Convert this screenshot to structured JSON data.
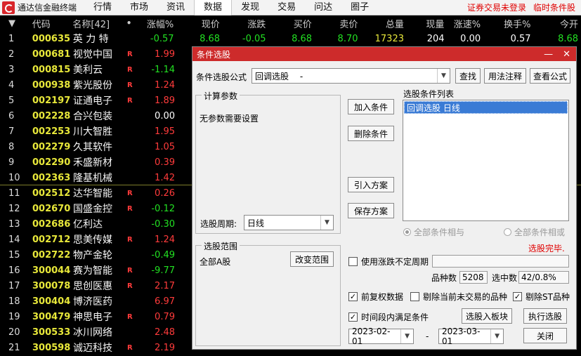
{
  "menubar": {
    "app_title": "通达信金融终端",
    "items": [
      "行情",
      "市场",
      "资讯",
      "数据",
      "发现",
      "交易",
      "问达",
      "圈子"
    ],
    "active_index": 3,
    "right_links": [
      "证券交易未登录",
      "临时条件股"
    ]
  },
  "table": {
    "headers": {
      "sort": "▼",
      "code": "代码",
      "name": "名称[42]",
      "dot": "•",
      "chg_pct": "涨幅%",
      "price": "现价",
      "chg": "涨跌",
      "bid": "买价",
      "ask": "卖价",
      "volume": "总量",
      "cur_vol": "现量",
      "speed": "涨速%",
      "turnover": "换手%",
      "open": "今开"
    },
    "rows": [
      {
        "idx": "1",
        "code": "000635",
        "name": "英 力 特",
        "r": "",
        "chg_pct": "-0.57",
        "dir": "down",
        "price": "8.68",
        "chg": "-0.05",
        "bid": "8.68",
        "ask": "8.70",
        "volume": "17323",
        "cur_vol": "204",
        "speed": "0.00",
        "turnover": "0.57",
        "open": "8.68"
      },
      {
        "idx": "2",
        "code": "000681",
        "name": "视觉中国",
        "r": "R",
        "chg_pct": "1.99",
        "dir": "up"
      },
      {
        "idx": "3",
        "code": "000815",
        "name": "美利云",
        "r": "R",
        "chg_pct": "-1.14",
        "dir": "down"
      },
      {
        "idx": "4",
        "code": "000938",
        "name": "紫光股份",
        "r": "R",
        "chg_pct": "1.24",
        "dir": "up"
      },
      {
        "idx": "5",
        "code": "002197",
        "name": "证通电子",
        "r": "R",
        "chg_pct": "1.89",
        "dir": "up"
      },
      {
        "idx": "6",
        "code": "002228",
        "name": "合兴包装",
        "r": "",
        "chg_pct": "0.00",
        "dir": "flat"
      },
      {
        "idx": "7",
        "code": "002253",
        "name": "川大智胜",
        "r": "",
        "chg_pct": "1.95",
        "dir": "up"
      },
      {
        "idx": "8",
        "code": "002279",
        "name": "久其软件",
        "r": "",
        "chg_pct": "1.05",
        "dir": "up"
      },
      {
        "idx": "9",
        "code": "002290",
        "name": "禾盛新材",
        "r": "",
        "chg_pct": "0.39",
        "dir": "up"
      },
      {
        "idx": "10",
        "code": "002363",
        "name": "隆基机械",
        "r": "",
        "chg_pct": "1.42",
        "dir": "up"
      },
      {
        "idx": "11",
        "code": "002512",
        "name": "达华智能",
        "r": "R",
        "chg_pct": "0.26",
        "dir": "up"
      },
      {
        "idx": "12",
        "code": "002670",
        "name": "国盛金控",
        "r": "R",
        "chg_pct": "-0.12",
        "dir": "down"
      },
      {
        "idx": "13",
        "code": "002686",
        "name": "亿利达",
        "r": "",
        "chg_pct": "-0.30",
        "dir": "down"
      },
      {
        "idx": "14",
        "code": "002712",
        "name": "思美传媒",
        "r": "R",
        "chg_pct": "1.24",
        "dir": "up"
      },
      {
        "idx": "15",
        "code": "002722",
        "name": "物产金轮",
        "r": "",
        "chg_pct": "-0.49",
        "dir": "down"
      },
      {
        "idx": "16",
        "code": "300044",
        "name": "赛为智能",
        "r": "R",
        "chg_pct": "-9.77",
        "dir": "down"
      },
      {
        "idx": "17",
        "code": "300078",
        "name": "思创医惠",
        "r": "R",
        "chg_pct": "2.17",
        "dir": "up"
      },
      {
        "idx": "18",
        "code": "300404",
        "name": "博济医药",
        "r": "",
        "chg_pct": "6.97",
        "dir": "up"
      },
      {
        "idx": "19",
        "code": "300479",
        "name": "神思电子",
        "r": "R",
        "chg_pct": "0.79",
        "dir": "up"
      },
      {
        "idx": "20",
        "code": "300533",
        "name": "冰川网络",
        "r": "",
        "chg_pct": "2.48",
        "dir": "up"
      },
      {
        "idx": "21",
        "code": "300598",
        "name": "诚迈科技",
        "r": "R",
        "chg_pct": "2.19",
        "dir": "up"
      }
    ]
  },
  "dialog": {
    "title": "条件选股",
    "minimize": "—",
    "close": "✕",
    "formula_label": "条件选股公式",
    "formula_value": "回调选股　 -",
    "find_button": "查找",
    "usage_button": "用法注释",
    "view_button": "查看公式",
    "params_group": "计算参数",
    "params_text": "无参数需要设置",
    "period_label": "选股周期:",
    "period_value": "日线",
    "add_button": "加入条件",
    "delete_button": "删除条件",
    "import_button": "引入方案",
    "save_button": "保存方案",
    "list_title": "选股条件列表",
    "list_items": [
      "回调选股  日线"
    ],
    "radio_all_match": "全部条件相与",
    "radio_any_match": "全部条件相或",
    "status": "选股完毕.",
    "scope_group": "选股范围",
    "scope_value": "全部A股",
    "change_scope_button": "改变范围",
    "use_period_label": "使用涨跌不定周期",
    "count_label": "品种数",
    "count_value": "5208",
    "selected_label": "选中数",
    "selected_value": "42/0.8%",
    "fq_label": "前复权数据",
    "exclude_untraded_label": "剔除当前未交易的品种",
    "exclude_st_label": "剔除ST品种",
    "period_cond_label": "时间段内满足条件",
    "to_block_button": "选股入板块",
    "run_button": "执行选股",
    "date_from": "2023-02-01",
    "date_sep": "-",
    "date_to": "2023-03-01",
    "close_button": "关闭"
  }
}
